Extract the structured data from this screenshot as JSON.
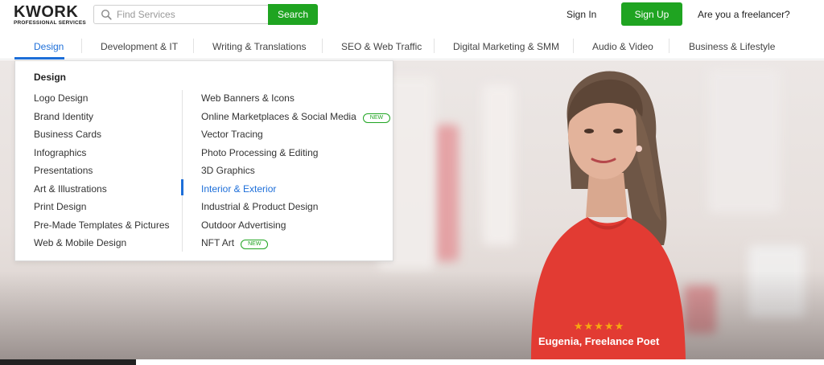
{
  "header": {
    "logo_main": "KWORK",
    "logo_sub": "PROFESSIONAL SERVICES",
    "search_placeholder": "Find Services",
    "search_button": "Search",
    "signin": "Sign In",
    "signup": "Sign Up",
    "freelancer": "Are you a freelancer?"
  },
  "nav": {
    "items": [
      "Design",
      "Development & IT",
      "Writing & Translations",
      "SEO & Web Traffic",
      "Digital Marketing & SMM",
      "Audio & Video",
      "Business & Lifestyle"
    ],
    "active": "Design"
  },
  "dropdown": {
    "title": "Design",
    "col1": [
      "Logo Design",
      "Brand Identity",
      "Business Cards",
      "Infographics",
      "Presentations",
      "Art & Illustrations",
      "Print Design",
      "Pre-Made Templates & Pictures",
      "Web & Mobile Design"
    ],
    "col2": [
      "Web Banners & Icons",
      "Online Marketplaces & Social Media",
      "Vector Tracing",
      "Photo Processing & Editing",
      "3D Graphics",
      "Interior & Exterior",
      "Industrial & Product Design",
      "Outdoor Advertising",
      "NFT Art"
    ],
    "new_badge": "NEW",
    "active_item": "Interior & Exterior"
  },
  "hero": {
    "rating_stars": "★★★★★",
    "caption": "Eugenia,  Freelance Poet"
  },
  "colors": {
    "accent_green": "#1fa421",
    "link_blue": "#1e6fd9",
    "star": "#f7a711"
  }
}
